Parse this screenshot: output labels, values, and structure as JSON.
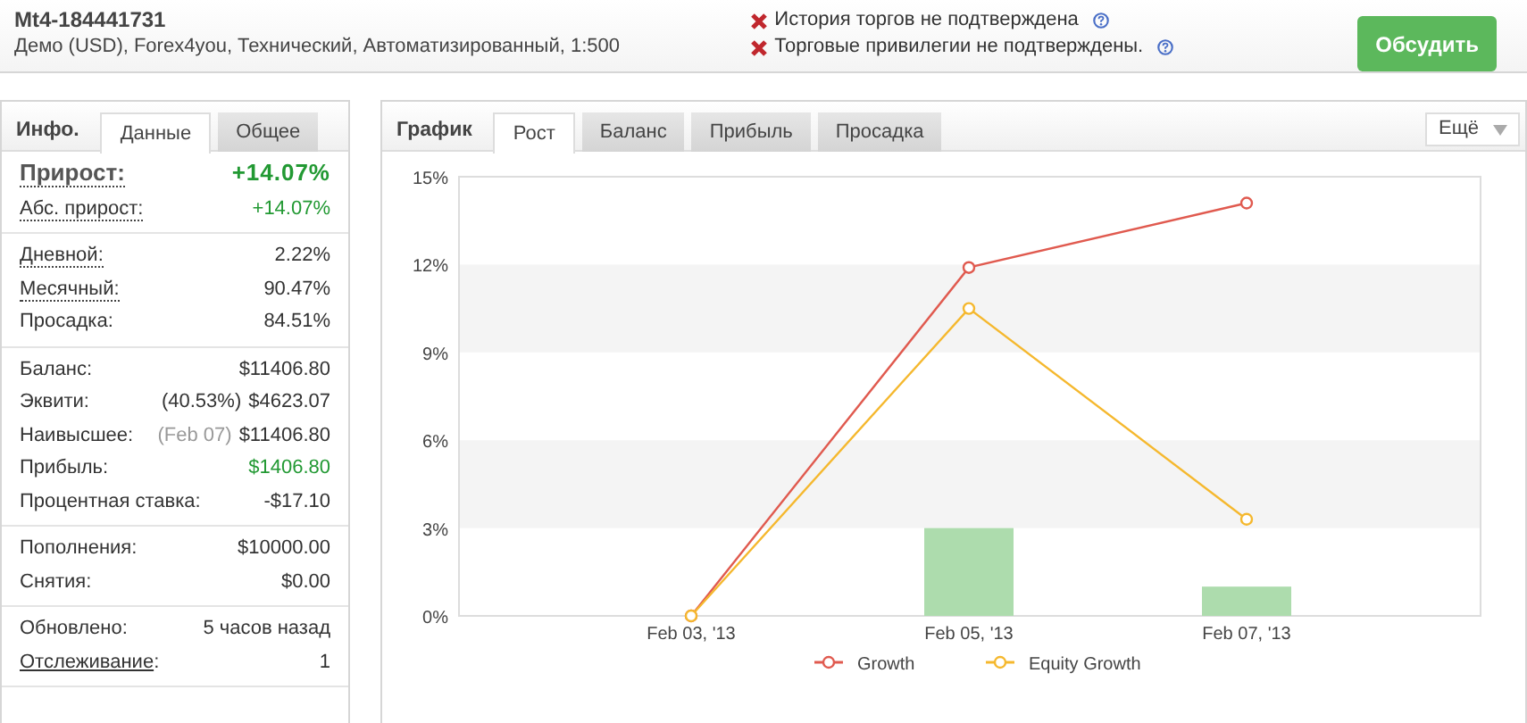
{
  "header": {
    "title": "Mt4-184441731",
    "subtitle": "Демо (USD), Forex4you, Технический, Автоматизированный, 1:500",
    "warnings": [
      {
        "text": "История торгов не подтверждена"
      },
      {
        "text": "Торговые привилегии не подтверждены."
      }
    ],
    "button": "Обсудить"
  },
  "info_panel": {
    "title": "Инфо.",
    "tabs": [
      {
        "label": "Данные",
        "selected": true
      },
      {
        "label": "Общее",
        "selected": false
      }
    ],
    "groups": [
      [
        {
          "label": "Прирост:",
          "kind": "headline",
          "value": "+14.07%",
          "color": "#229933"
        },
        {
          "label": "Абс. прирост:",
          "kind": "dotted",
          "value": "+14.07%",
          "color": "#229933"
        }
      ],
      [
        {
          "label": "Дневной:",
          "kind": "dotted",
          "value": "2.22%"
        },
        {
          "label": "Месячный:",
          "kind": "dotted",
          "value": "90.47%"
        },
        {
          "label": "Просадка:",
          "kind": "plain",
          "value": "84.51%"
        }
      ],
      [
        {
          "label": "Баланс:",
          "kind": "plain",
          "value": "$11406.80"
        },
        {
          "label": "Эквити:",
          "kind": "plain",
          "note": "(40.53%)",
          "muted": false,
          "value": "$4623.07"
        },
        {
          "label": "Наивысшее:",
          "kind": "plain",
          "note": "(Feb 07)",
          "muted": true,
          "value": "$11406.80"
        },
        {
          "label": "Прибыль:",
          "kind": "plain",
          "value": "$1406.80",
          "color": "#229933"
        },
        {
          "label": "Процентная ставка:",
          "kind": "plain",
          "value": "-$17.10"
        }
      ],
      [
        {
          "label": "Пополнения:",
          "kind": "plain",
          "value": "$10000.00"
        },
        {
          "label": "Снятия:",
          "kind": "plain",
          "value": "$0.00"
        }
      ],
      [
        {
          "label": "Обновлено:",
          "kind": "plain",
          "value": "5 часов назад"
        },
        {
          "label": "Отслеживание",
          "suffix": ":",
          "kind": "link",
          "value": "1"
        }
      ]
    ]
  },
  "chart_panel": {
    "title": "График",
    "tabs": [
      {
        "label": "Рост",
        "selected": true
      },
      {
        "label": "Баланс",
        "selected": false
      },
      {
        "label": "Прибыль",
        "selected": false
      },
      {
        "label": "Просадка",
        "selected": false
      }
    ],
    "more_button": "Ещё",
    "chart_data": {
      "type": "line",
      "legend": "bottom",
      "categories": [
        "Feb 03, '13",
        "Feb 05, '13",
        "Feb 07, '13"
      ],
      "ylim": [
        0,
        15
      ],
      "yticks": [
        {
          "value": 0,
          "label": "0%"
        },
        {
          "value": 3,
          "label": "3%"
        },
        {
          "value": 6,
          "label": "6%"
        },
        {
          "value": 9,
          "label": "9%"
        },
        {
          "value": 12,
          "label": "12%"
        },
        {
          "value": 15,
          "label": "15%"
        }
      ],
      "series": [
        {
          "name": "Growth",
          "color": "#e05a4f",
          "marker": "circle",
          "values": [
            0,
            11.9,
            14.1
          ]
        },
        {
          "name": "Equity Growth",
          "color": "#f5b82e",
          "marker": "circle",
          "values": [
            0,
            10.5,
            3.3
          ]
        },
        {
          "color": "#addcad",
          "type": "bar",
          "values": [
            null,
            3.0,
            1.0
          ]
        }
      ]
    }
  }
}
